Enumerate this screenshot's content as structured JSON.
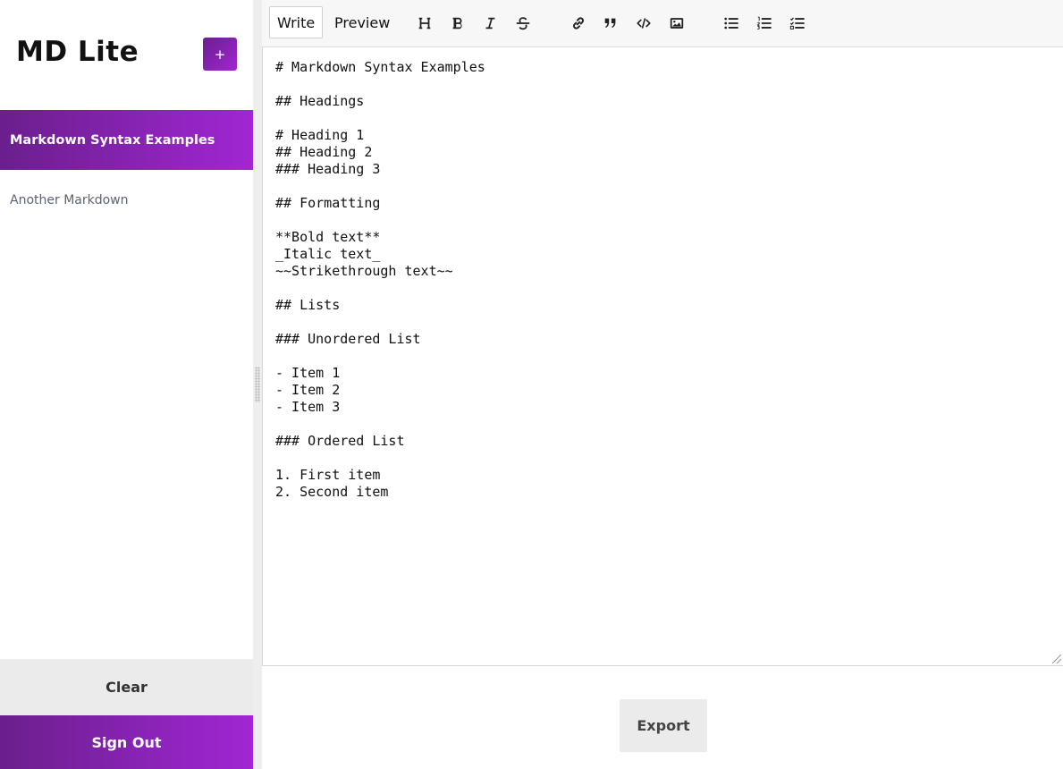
{
  "app": {
    "title": "MD Lite"
  },
  "sidebar": {
    "add_label": "+",
    "documents": [
      {
        "label": "Markdown Syntax Examples",
        "active": true
      },
      {
        "label": "Another Markdown",
        "active": false
      }
    ],
    "clear_label": "Clear",
    "signout_label": "Sign Out"
  },
  "editor": {
    "tabs": {
      "write": "Write",
      "preview": "Preview"
    },
    "tools": [
      {
        "name": "heading-icon"
      },
      {
        "name": "bold-icon"
      },
      {
        "name": "italic-icon"
      },
      {
        "name": "strikethrough-icon"
      },
      {
        "name": "link-icon"
      },
      {
        "name": "quote-icon"
      },
      {
        "name": "code-icon"
      },
      {
        "name": "image-icon"
      },
      {
        "name": "unordered-list-icon"
      },
      {
        "name": "ordered-list-icon"
      },
      {
        "name": "task-list-icon"
      }
    ],
    "content": "# Markdown Syntax Examples\n\n## Headings\n\n# Heading 1\n## Heading 2\n### Heading 3\n\n## Formatting\n\n**Bold text**\n_Italic text_\n~~Strikethrough text~~\n\n## Lists\n\n### Unordered List\n\n- Item 1\n- Item 2\n- Item 3\n\n### Ordered List\n\n1. First item\n2. Second item"
  },
  "footer": {
    "export_label": "Export"
  },
  "colors": {
    "accent_start": "#6a1f8c",
    "accent_end": "#a126d4"
  }
}
